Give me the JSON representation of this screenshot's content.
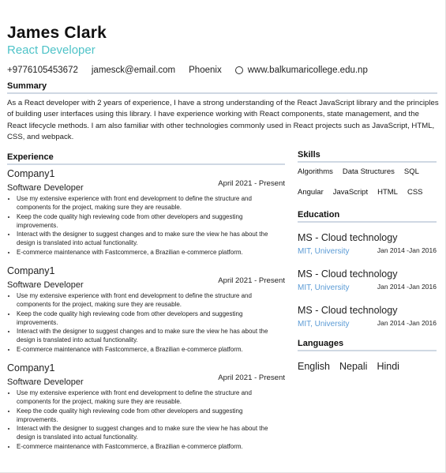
{
  "header": {
    "name": "James Clark",
    "role": "React Developer",
    "phone": "+9776105453672",
    "email": "jamesck@email.com",
    "location": "Phoenix",
    "website": "www.balkumaricollege.edu.np",
    "website_icon": "globe-icon"
  },
  "summary": {
    "title": "Summary",
    "text": "As a React developer with 2 years of experience, I have a strong understanding of the React JavaScript library and the principles of building user interfaces using this library. I have experience working with React components, state management, and the React lifecycle methods. I am also familiar with other technologies commonly used in React projects such as JavaScript, HTML, CSS, and webpack."
  },
  "experience": {
    "title": "Experience",
    "jobs": [
      {
        "company": "Company1",
        "title": "Software Developer",
        "date": "April 2021 - Present",
        "bullets": [
          "Use my extensive experience with front end development to define the structure and components for the project, making sure they are reusable.",
          "Keep the code quality high reviewing code from other developers and suggesting improvements.",
          "Interact with the designer to suggest changes and to make sure the view he has about the design is translated into actual functionality.",
          "E-commerce maintenance with Fastcommerce, a Brazilian e-commerce platform."
        ]
      },
      {
        "company": "Company1",
        "title": "Software Developer",
        "date": "April 2021 - Present",
        "bullets": [
          "Use my extensive experience with front end development to define the structure and components for the project, making sure they are reusable.",
          "Keep the code quality high reviewing code from other developers and suggesting improvements.",
          "Interact with the designer to suggest changes and to make sure the view he has about the design is translated into actual functionality.",
          "E-commerce maintenance with Fastcommerce, a Brazilian e-commerce platform."
        ]
      },
      {
        "company": "Company1",
        "title": "Software Developer",
        "date": "April 2021 - Present",
        "bullets": [
          "Use my extensive experience with front end development to define the structure and components for the project, making sure they are reusable.",
          "Keep the code quality high reviewing code from other developers and suggesting improvements.",
          "Interact with the designer to suggest changes and to make sure the view he has about the design is translated into actual functionality.",
          "E-commerce maintenance with Fastcommerce, a Brazilian e-commerce platform."
        ]
      }
    ]
  },
  "skills": {
    "title": "Skills",
    "items": [
      "Algorithms",
      "Data Structures",
      "SQL",
      "Angular",
      "JavaScript",
      "HTML",
      "CSS"
    ]
  },
  "education": {
    "title": "Education",
    "items": [
      {
        "degree": "MS - Cloud technology",
        "school": "MIT, University",
        "date": "Jan 2014 -Jan 2016"
      },
      {
        "degree": "MS - Cloud technology",
        "school": "MIT, University",
        "date": "Jan 2014 -Jan 2016"
      },
      {
        "degree": "MS - Cloud technology",
        "school": "MIT, University",
        "date": "Jan 2014 -Jan 2016"
      }
    ]
  },
  "languages": {
    "title": "Languages",
    "items": [
      "English",
      "Nepali",
      "Hindi"
    ]
  },
  "colors": {
    "accent": "#4fc3c8",
    "link": "#5b9bd5",
    "rule": "#cfd8e3"
  }
}
